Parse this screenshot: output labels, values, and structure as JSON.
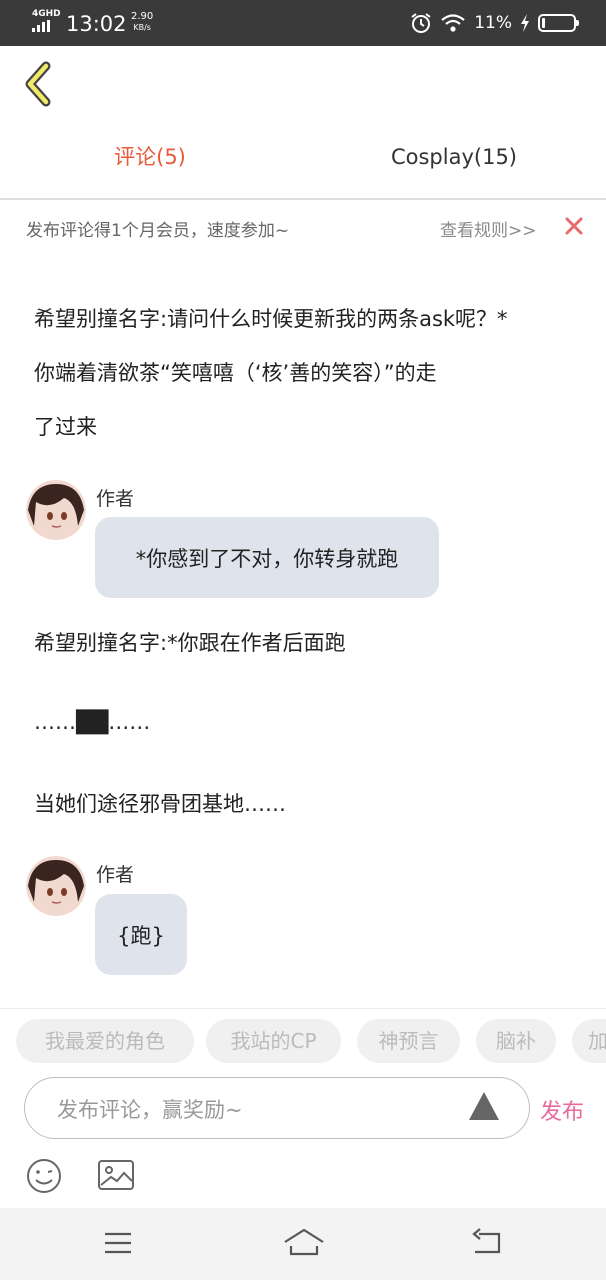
{
  "status_bar": {
    "network": "4GHD",
    "time": "13:02",
    "speed_value": "2.90",
    "speed_unit": "KB/s",
    "battery_percent": "11%",
    "battery_level": 0.11,
    "icons": [
      "signal-icon",
      "alarm-icon",
      "wifi-icon",
      "charging-icon",
      "battery-icon"
    ]
  },
  "header": {
    "back_icon": "chevron-left-icon",
    "tabs": [
      {
        "label": "评论(5)",
        "active": true
      },
      {
        "label": "Cosplay(15)",
        "active": false
      }
    ]
  },
  "notice": {
    "text": "发布评论得1个月会员，速度参加~",
    "rules_link": "查看规则>>",
    "close_icon": "close-icon"
  },
  "messages": [
    {
      "type": "user",
      "lines": [
        "希望别撞名字:请问什么时候更新我的两条ask呢？*",
        "你端着清欲茶“笑嘻嘻（‘核’善的笑容）”的走",
        "了过来"
      ]
    },
    {
      "type": "author",
      "name": "作者",
      "text": "*你感到了不对，你转身就跑"
    },
    {
      "type": "user",
      "lines": [
        "希望别撞名字:*你跟在作者后面跑"
      ]
    },
    {
      "type": "user",
      "lines": [
        "……██……"
      ]
    },
    {
      "type": "user",
      "lines": [
        "当她们途径邪骨团基地……"
      ]
    },
    {
      "type": "author",
      "name": "作者",
      "text": "{跑}"
    }
  ],
  "chips": [
    "我最爱的角色",
    "我站的CP",
    "神预言",
    "脑补",
    "加"
  ],
  "composer": {
    "placeholder": "发布评论，赢奖励~",
    "send_label": "发布",
    "send_icon": "triangle-up-icon",
    "emoji_icon": "smiley-icon",
    "image_icon": "image-icon"
  },
  "navbar": {
    "icons": [
      "menu-icon",
      "home-icon",
      "back-icon"
    ]
  },
  "colors": {
    "accent": "#e85a3a",
    "publish": "#e86a9a",
    "bubble": "#dfe4ec",
    "close": "#e86a6a"
  }
}
